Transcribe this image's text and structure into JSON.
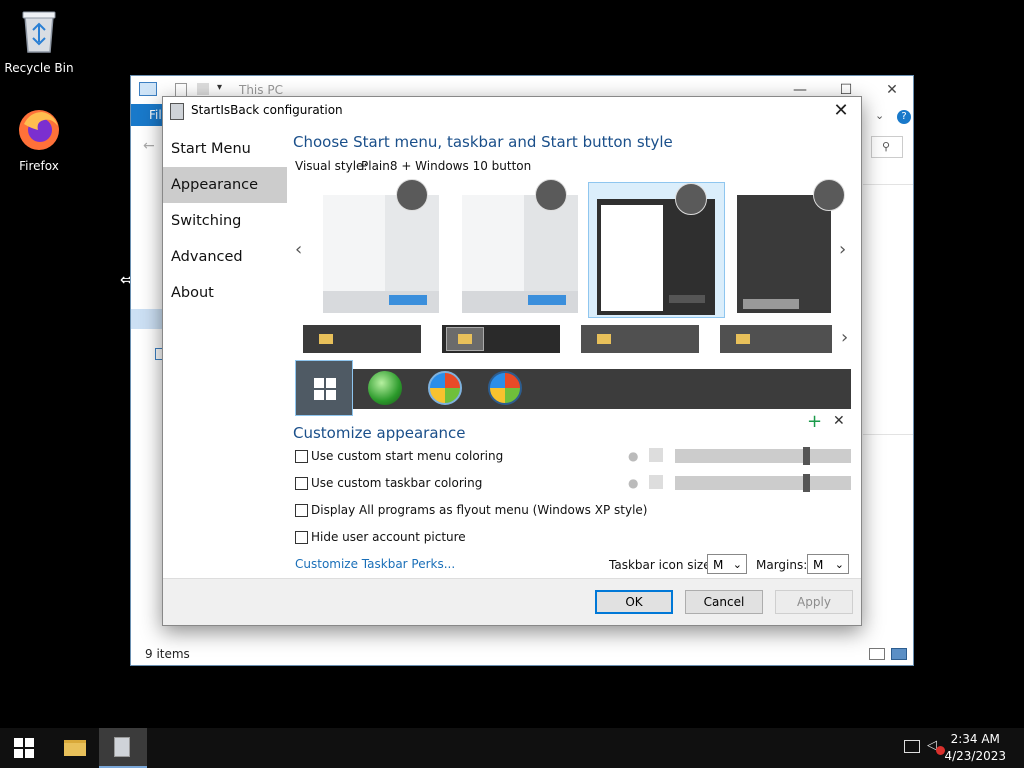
{
  "desktop": {
    "icons": [
      {
        "label": "Recycle Bin",
        "icon": "recycle-bin-icon"
      },
      {
        "label": "Firefox",
        "icon": "firefox-icon"
      }
    ]
  },
  "explorer": {
    "title": "This PC",
    "file_tab": "Fil",
    "status": "9 items"
  },
  "dialog": {
    "title": "StartIsBack configuration",
    "nav": [
      "Start Menu",
      "Appearance",
      "Switching",
      "Advanced",
      "About"
    ],
    "selected_nav": "Appearance",
    "heading": "Choose Start menu, taskbar and Start button style",
    "visual_style_label": "Visual style:",
    "visual_style_value": "Plain8 + Windows 10 button",
    "customize_heading": "Customize appearance",
    "options": [
      {
        "label": "Use custom start menu coloring",
        "checked": false
      },
      {
        "label": "Use custom taskbar coloring",
        "checked": false
      },
      {
        "label": "Display All programs as flyout menu (Windows XP style)",
        "checked": false
      },
      {
        "label": "Hide user account picture",
        "checked": false
      }
    ],
    "perks_link": "Customize Taskbar Perks...",
    "icon_size_label": "Taskbar icon size:",
    "icon_size_value": "M",
    "margins_label": "Margins:",
    "margins_value": "M",
    "buttons": {
      "ok": "OK",
      "cancel": "Cancel",
      "apply": "Apply"
    }
  },
  "taskbar": {
    "time": "2:34 AM",
    "date": "4/23/2023"
  },
  "colors": {
    "accent": "#0078d7",
    "heading": "#1a4f8a",
    "taskbar": "#101010"
  }
}
